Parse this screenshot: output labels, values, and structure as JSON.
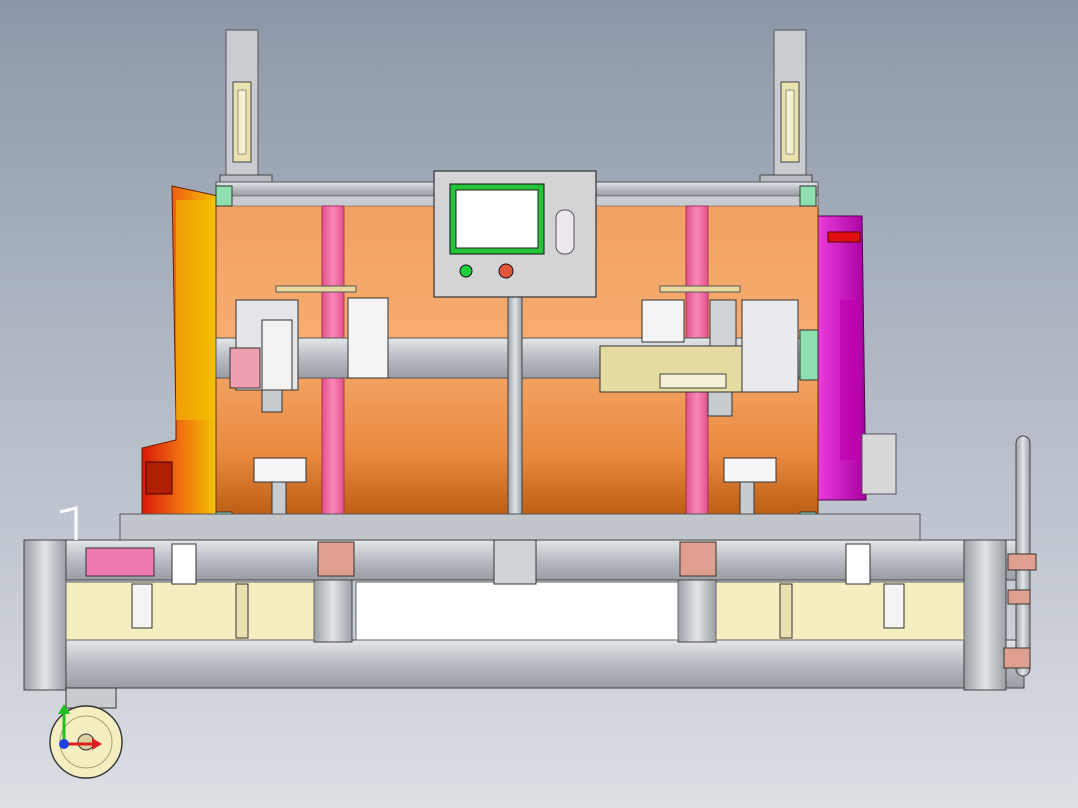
{
  "viewport": {
    "background_top": "#8e99aa",
    "background_bottom": "#d9dde3"
  },
  "colors": {
    "drum_orange": "#f4a060",
    "drum_dark": "#e06820",
    "frame_gray": "#c8cbd0",
    "frame_dark": "#8a8e94",
    "strap_pink": "#f06aa0",
    "cap_yellow": "#f2c200",
    "cap_red": "#e02010",
    "cap_magenta": "#e020d0",
    "panel_gray": "#d6d6d6",
    "screen_green": "#22c43a",
    "pad_mint": "#8fe0b0",
    "bracket_copper": "#e0a090",
    "wheel_cream": "#f4eec0"
  },
  "control_panel": {
    "screen_icon": "screen-icon",
    "green_button_color": "#1ed03a",
    "red_button_color": "#e4553a",
    "switch_icon": "key-switch-icon"
  },
  "triad": {
    "x_color": "#e02020",
    "y_color": "#20c020",
    "z_color": "#2040e0"
  }
}
